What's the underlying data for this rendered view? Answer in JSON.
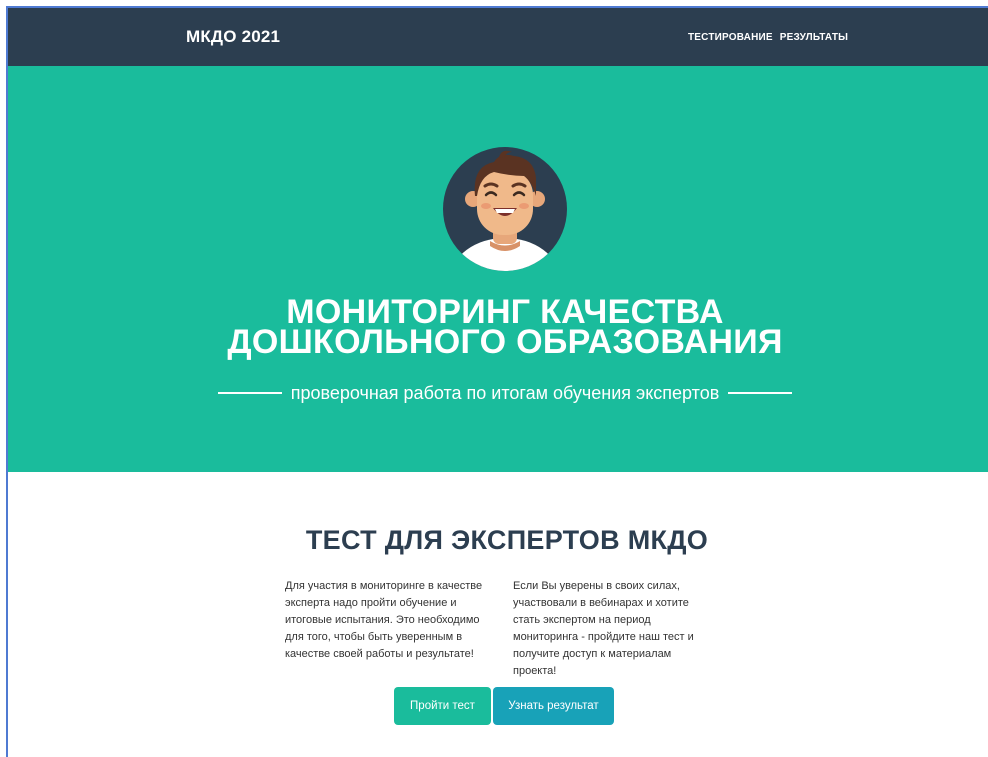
{
  "navbar": {
    "brand": "МКДО 2021",
    "links": [
      "ТЕСТИРОВАНИЕ",
      "РЕЗУЛЬТАТЫ"
    ]
  },
  "hero": {
    "title_line1": "МОНИТОРИНГ КАЧЕСТВА",
    "title_line2": "ДОШКОЛЬНОГО ОБРАЗОВАНИЯ",
    "subtitle": "проверочная работа по итогам обучения экспертов",
    "avatar_icon": "smiling-man-avatar"
  },
  "main": {
    "title": "ТЕСТ ДЛЯ ЭКСПЕРТОВ МКДО",
    "left_text": "Для участия в мониторинге в качестве эксперта надо пройти обучение и итоговые испытания. Это необходимо для того, чтобы быть уверенным в качестве своей работы и результате!",
    "right_text": "Если Вы уверены в своих силах, участвовали в вебинарах и хотите стать экспертом на период мониторинга - пройдите наш тест и получите доступ к материалам проекта!",
    "buttons": {
      "take_test": "Пройти тест",
      "get_result": "Узнать результат"
    }
  },
  "colors": {
    "navbar_bg": "#2c3e50",
    "hero_bg": "#1abc9c",
    "primary_button": "#1abc9c",
    "info_button": "#18a2b8"
  }
}
